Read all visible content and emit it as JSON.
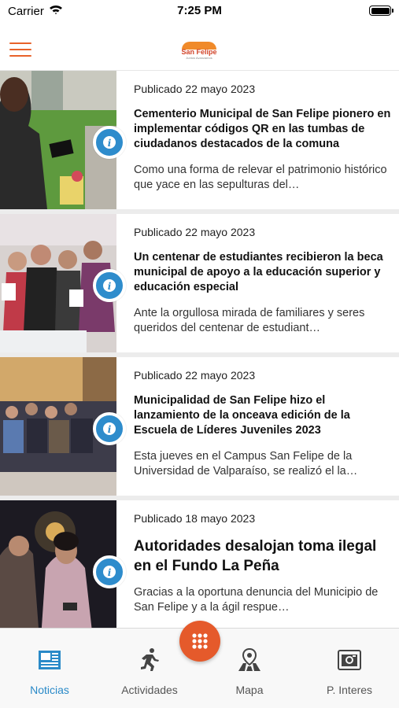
{
  "status_bar": {
    "carrier": "Carrier",
    "time": "7:25 PM"
  },
  "header": {
    "logo_text": "San Felipe",
    "logo_subtitle": "Juntos Avanzamos"
  },
  "articles": [
    {
      "date": "Publicado 22 mayo 2023",
      "title": "Cementerio Municipal de San Felipe pionero en implementar códigos QR en las tumbas de ciudadanos destacados de la comuna",
      "excerpt": "Como una forma de relevar el patrimonio histórico que yace en las sepulturas del…"
    },
    {
      "date": "Publicado 22 mayo 2023",
      "title": "Un centenar de estudiantes recibieron la beca municipal de apoyo a la educación superior y educación especial",
      "excerpt": "Ante la orgullosa mirada de familiares y seres queridos del centenar de estudiant…"
    },
    {
      "date": "Publicado 22 mayo 2023",
      "title": "Municipalidad de San Felipe hizo el lanzamiento de la onceava edición de la Escuela de Líderes Juveniles 2023",
      "excerpt": "Esta jueves en el Campus San Felipe de la Universidad de Valparaíso, se realizó el la…"
    },
    {
      "date": "Publicado 18 mayo 2023",
      "title": "Autoridades desalojan toma ilegal en el Fundo La Peña",
      "excerpt": "Gracias a la oportuna denuncia del Municipio de San Felipe y a la ágil respue…"
    }
  ],
  "tabs": [
    {
      "label": "Noticias",
      "icon": "newspaper-icon",
      "active": true
    },
    {
      "label": "Actividades",
      "icon": "running-icon",
      "active": false
    },
    {
      "label": "Mapa",
      "icon": "map-pin-icon",
      "active": false
    },
    {
      "label": "P. Interes",
      "icon": "camera-icon",
      "active": false
    }
  ],
  "colors": {
    "accent": "#e8622a",
    "info_blue": "#2e8ccc",
    "active_tab": "#2a8ac8",
    "fab": "#e55a2b"
  }
}
